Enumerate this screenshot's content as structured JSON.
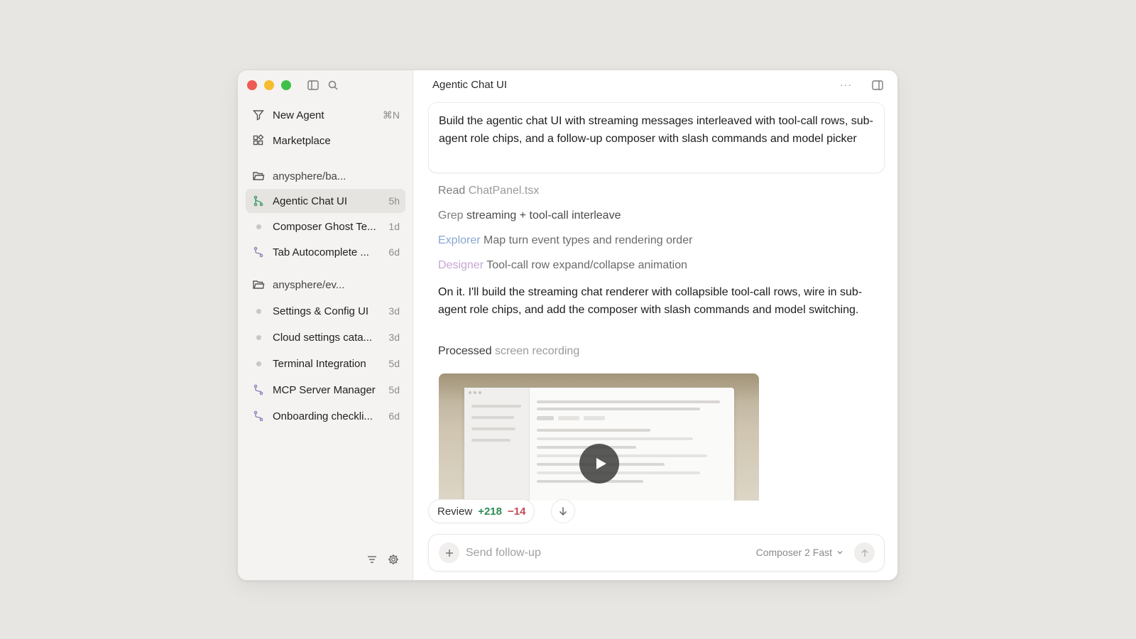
{
  "window": {
    "title": "Agentic Chat UI"
  },
  "sidebar": {
    "actions": [
      {
        "label": "New Agent",
        "shortcut": "⌘N",
        "icon": "new-agent-icon"
      },
      {
        "label": "Marketplace",
        "icon": "marketplace-icon"
      }
    ],
    "groups": [
      {
        "folder": "anysphere/ba...",
        "items": [
          {
            "label": "Agentic Chat UI",
            "time": "5h",
            "icon": "branch-icon",
            "active": true
          },
          {
            "label": "Composer Ghost Te...",
            "time": "1d",
            "icon": "bullet-icon"
          },
          {
            "label": "Tab Autocomplete ...",
            "time": "6d",
            "icon": "branch-icon"
          }
        ]
      },
      {
        "folder": "anysphere/ev...",
        "items": [
          {
            "label": "Settings & Config UI",
            "time": "3d",
            "icon": "bullet-icon"
          },
          {
            "label": "Cloud settings cata...",
            "time": "3d",
            "icon": "bullet-icon"
          },
          {
            "label": "Terminal Integration",
            "time": "5d",
            "icon": "bullet-icon"
          },
          {
            "label": "MCP Server Manager",
            "time": "5d",
            "icon": "branch-icon"
          },
          {
            "label": "Onboarding checkli...",
            "time": "6d",
            "icon": "branch-icon"
          }
        ]
      }
    ]
  },
  "chat": {
    "prompt": "Build the agentic chat UI with streaming messages interleaved with tool-call rows, sub-agent role chips, and a follow-up composer with slash commands and model picker",
    "steps": [
      {
        "kind": "Read",
        "detail": "ChatPanel.tsx"
      },
      {
        "kind": "Grep",
        "detail": "streaming + tool-call interleave"
      },
      {
        "kind": "Explorer",
        "detail": "Map turn event types and rendering order"
      },
      {
        "kind": "Designer",
        "detail": "Tool-call row expand/collapse animation"
      }
    ],
    "response": "On it. I'll build the streaming chat renderer with collapsible tool-call rows, wire in sub-agent role chips, and add the composer with slash commands and model switching.",
    "processed": {
      "kind": "Processed",
      "detail": "screen recording"
    },
    "review": {
      "label": "Review",
      "added": "+218",
      "removed": "−14"
    }
  },
  "composer": {
    "placeholder": "Send follow-up",
    "model": "Composer 2 Fast"
  },
  "colors": {
    "explorer": "#8aa6d2",
    "designer": "#c7a6d3",
    "added": "#2e8b57",
    "removed": "#c24a5a"
  }
}
